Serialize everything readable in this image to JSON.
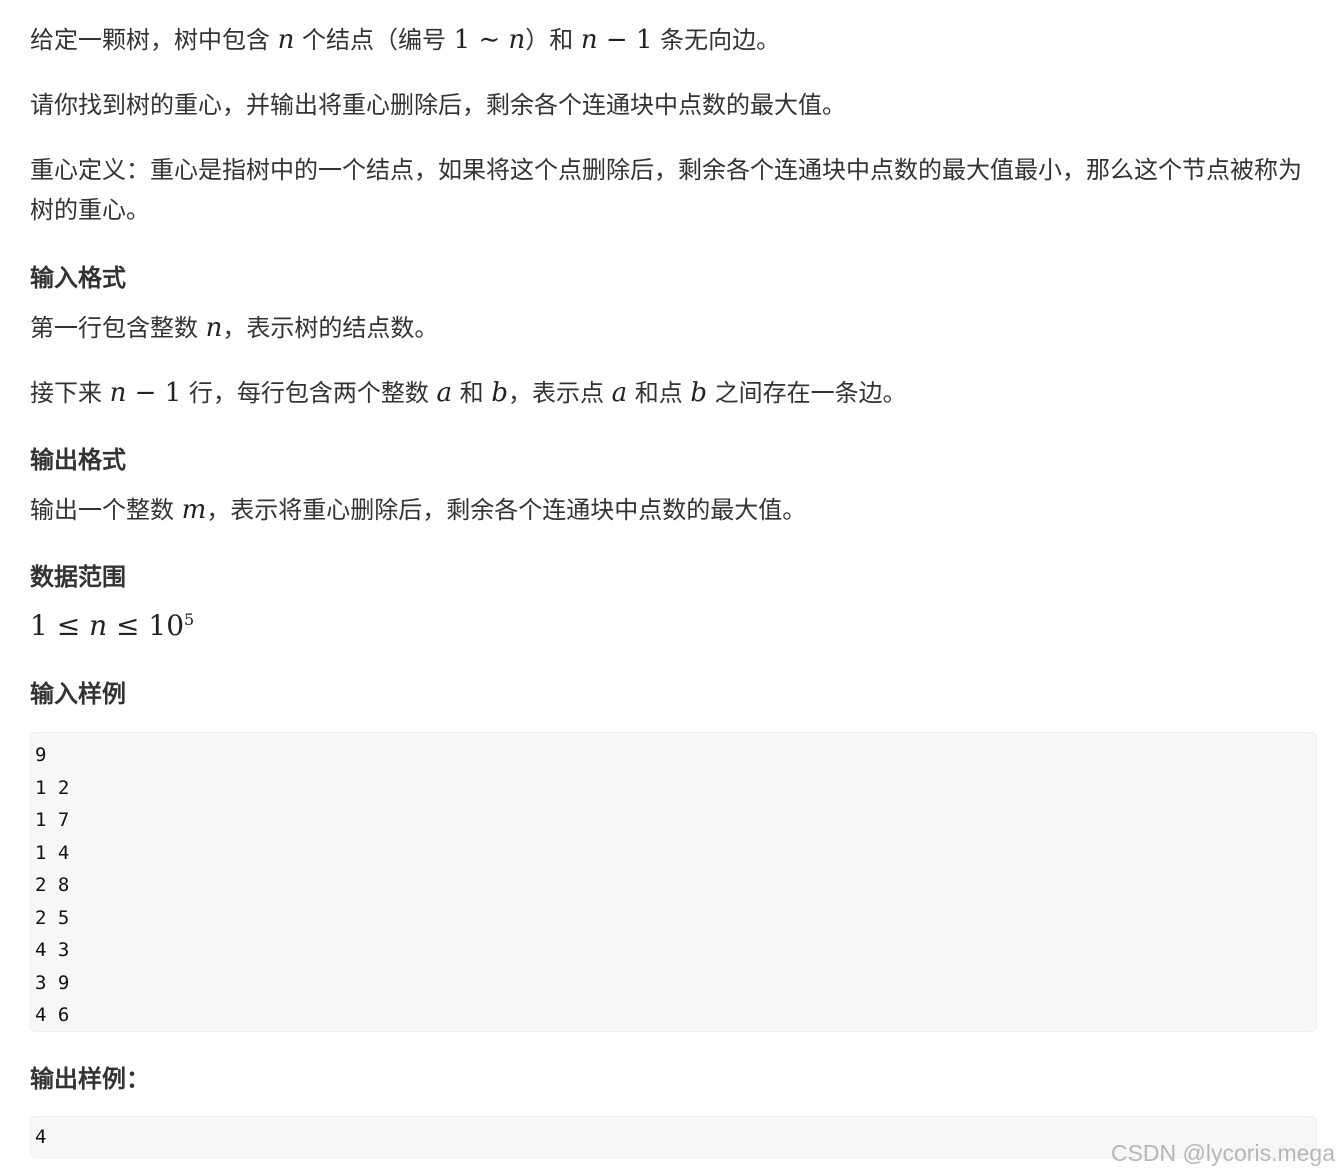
{
  "problem": {
    "intro": {
      "part1": "给定一颗树，树中包含 ",
      "var_n": "n",
      "part2": " 个结点（编号 ",
      "range_start": "1",
      "tilde": " ∼ ",
      "range_end": "n",
      "part3": "）和 ",
      "edges_n": "n",
      "minus": " − ",
      "one": "1",
      "part4": " 条无向边。"
    },
    "task": "请你找到树的重心，并输出将重心删除后，剩余各个连通块中点数的最大值。",
    "definition": "重心定义：重心是指树中的一个结点，如果将这个点删除后，剩余各个连通块中点数的最大值最小，那么这个节点被称为树的重心。",
    "input_format": {
      "heading": "输入格式",
      "line1_part1": "第一行包含整数 ",
      "line1_var": "n",
      "line1_part2": "，表示树的结点数。",
      "line2_part1": "接下来 ",
      "line2_n": "n",
      "line2_minus": " − ",
      "line2_one": "1",
      "line2_part2": " 行，每行包含两个整数 ",
      "line2_a": "a",
      "line2_and": " 和 ",
      "line2_b": "b",
      "line2_part3": "，表示点 ",
      "line2_a2": "a",
      "line2_and2": " 和点 ",
      "line2_b2": "b",
      "line2_part4": " 之间存在一条边。"
    },
    "output_format": {
      "heading": "输出格式",
      "part1": "输出一个整数 ",
      "var_m": "m",
      "part2": "，表示将重心删除后，剩余各个连通块中点数的最大值。"
    },
    "data_range": {
      "heading": "数据范围",
      "lower": "1",
      "le1": " ≤ ",
      "var": "n",
      "le2": " ≤ ",
      "base": "10",
      "exp": "5"
    },
    "sample_input": {
      "heading": "输入样例",
      "lines": [
        "9",
        "1 2",
        "1 7",
        "1 4",
        "2 8",
        "2 5",
        "4 3",
        "3 9",
        "4 6"
      ]
    },
    "sample_output": {
      "heading": "输出样例：",
      "lines": [
        "4"
      ]
    }
  },
  "watermark": "CSDN @lycoris.mega"
}
